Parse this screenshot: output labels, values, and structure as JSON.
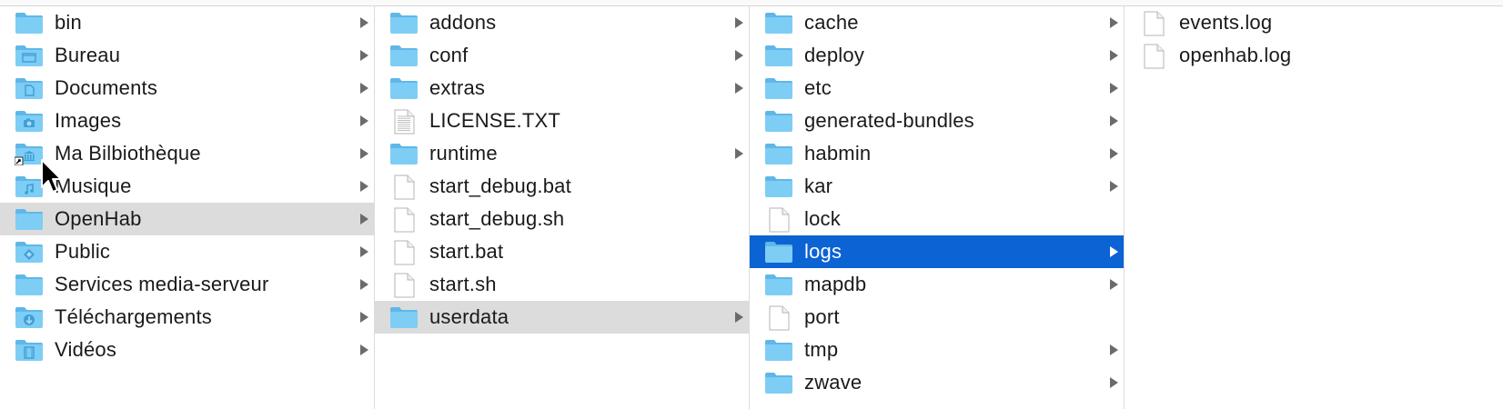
{
  "colors": {
    "folder": "#7ecdf5",
    "folder_dark": "#5fb7e8",
    "selected_gray": "#dcdcdc",
    "selected_blue": "#0b63d4"
  },
  "columns": [
    {
      "items": [
        {
          "label": "bin",
          "icon": "folder-icon",
          "has_children": true
        },
        {
          "label": "Bureau",
          "icon": "desktop-folder-icon",
          "has_children": true
        },
        {
          "label": "Documents",
          "icon": "documents-folder-icon",
          "has_children": true
        },
        {
          "label": "Images",
          "icon": "pictures-folder-icon",
          "has_children": true
        },
        {
          "label": "Ma Bilbiothèque",
          "icon": "library-folder-alias-icon",
          "has_children": true
        },
        {
          "label": "Musique",
          "icon": "music-folder-icon",
          "has_children": true
        },
        {
          "label": "OpenHab",
          "icon": "folder-icon",
          "has_children": true,
          "selected": "gray"
        },
        {
          "label": "Public",
          "icon": "public-folder-icon",
          "has_children": true
        },
        {
          "label": "Services media-serveur",
          "icon": "folder-icon",
          "has_children": true
        },
        {
          "label": "Téléchargements",
          "icon": "downloads-folder-icon",
          "has_children": true
        },
        {
          "label": "Vidéos",
          "icon": "movies-folder-icon",
          "has_children": true
        }
      ]
    },
    {
      "items": [
        {
          "label": "addons",
          "icon": "folder-icon",
          "has_children": true
        },
        {
          "label": "conf",
          "icon": "folder-icon",
          "has_children": true
        },
        {
          "label": "extras",
          "icon": "folder-icon",
          "has_children": true
        },
        {
          "label": "LICENSE.TXT",
          "icon": "text-file-icon",
          "has_children": false
        },
        {
          "label": "runtime",
          "icon": "folder-icon",
          "has_children": true
        },
        {
          "label": "start_debug.bat",
          "icon": "file-icon",
          "has_children": false
        },
        {
          "label": "start_debug.sh",
          "icon": "file-icon",
          "has_children": false
        },
        {
          "label": "start.bat",
          "icon": "file-icon",
          "has_children": false
        },
        {
          "label": "start.sh",
          "icon": "file-icon",
          "has_children": false
        },
        {
          "label": "userdata",
          "icon": "folder-icon",
          "has_children": true,
          "selected": "gray"
        }
      ]
    },
    {
      "items": [
        {
          "label": "cache",
          "icon": "folder-icon",
          "has_children": true
        },
        {
          "label": "deploy",
          "icon": "folder-icon",
          "has_children": true
        },
        {
          "label": "etc",
          "icon": "folder-icon",
          "has_children": true
        },
        {
          "label": "generated-bundles",
          "icon": "folder-icon",
          "has_children": true
        },
        {
          "label": "habmin",
          "icon": "folder-icon",
          "has_children": true
        },
        {
          "label": "kar",
          "icon": "folder-icon",
          "has_children": true
        },
        {
          "label": "lock",
          "icon": "file-icon",
          "has_children": false
        },
        {
          "label": "logs",
          "icon": "folder-icon",
          "has_children": true,
          "selected": "blue"
        },
        {
          "label": "mapdb",
          "icon": "folder-icon",
          "has_children": true
        },
        {
          "label": "port",
          "icon": "file-icon",
          "has_children": false
        },
        {
          "label": "tmp",
          "icon": "folder-icon",
          "has_children": true
        },
        {
          "label": "zwave",
          "icon": "folder-icon",
          "has_children": true
        }
      ]
    },
    {
      "items": [
        {
          "label": "events.log",
          "icon": "file-icon",
          "has_children": false
        },
        {
          "label": "openhab.log",
          "icon": "file-icon",
          "has_children": false
        }
      ]
    }
  ]
}
